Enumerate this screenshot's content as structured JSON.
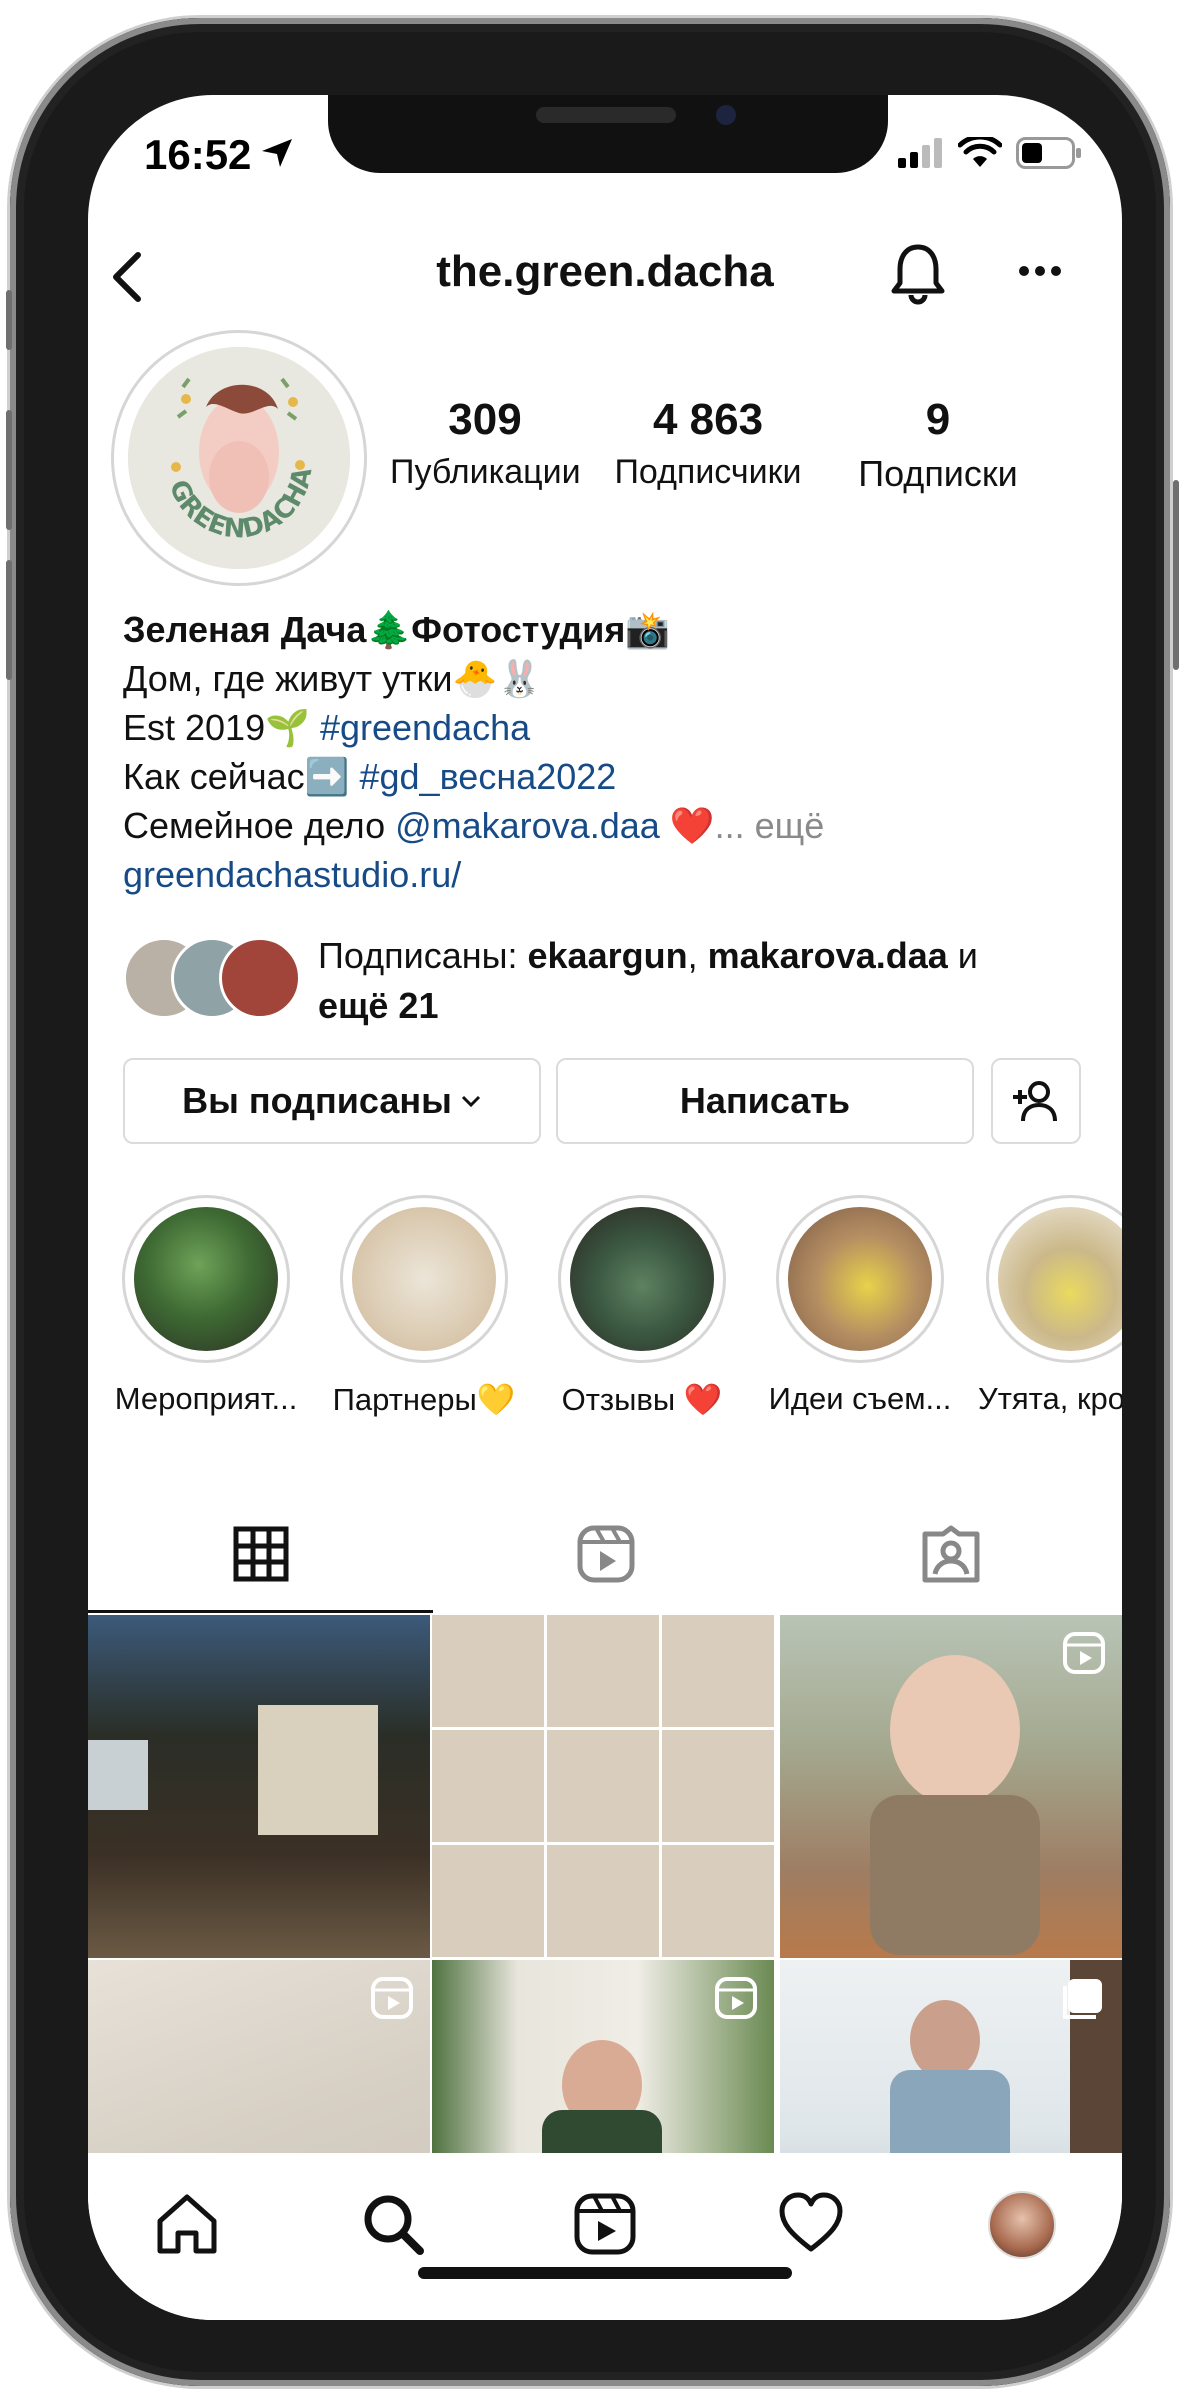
{
  "status": {
    "time": "16:52"
  },
  "header": {
    "username": "the.green.dacha"
  },
  "profile": {
    "avatar_text": "GREENDACHA",
    "stats": [
      {
        "value": "309",
        "label": "Публикации"
      },
      {
        "value": "4 863",
        "label": "Подписчики"
      },
      {
        "value": "9",
        "label": "Подписки"
      }
    ]
  },
  "bio": {
    "name": "Зеленая Дача🌲Фотостудия📸",
    "line1": "Дом, где живут утки🐣🐰",
    "line2_prefix": "Est 2019🌱 ",
    "line2_tag": "#greendacha",
    "line3_prefix": "Как сейчас➡️ ",
    "line3_tag": "#gd_весна2022",
    "line4_prefix": "Семейное дело ",
    "line4_mention": "@makarova.daa",
    "line4_heart": " ❤️",
    "line4_more": "... ещё",
    "website": "greendachastudio.ru/"
  },
  "followed_by": {
    "prefix": "Подписаны: ",
    "user1": "ekaargun",
    "sep": ", ",
    "user2": "makarova.daa",
    "and": " и",
    "more": "ещё 21"
  },
  "buttons": {
    "following": "Вы подписаны",
    "message": "Написать"
  },
  "highlights": [
    {
      "label": "Мероприят..."
    },
    {
      "label": "Партнеры💛"
    },
    {
      "label": "Отзывы ❤️"
    },
    {
      "label": "Идеи съем..."
    },
    {
      "label": "Утята, кро"
    }
  ],
  "colors": {
    "link": "#174b87",
    "text": "#111111",
    "border": "#dbdbdb"
  }
}
